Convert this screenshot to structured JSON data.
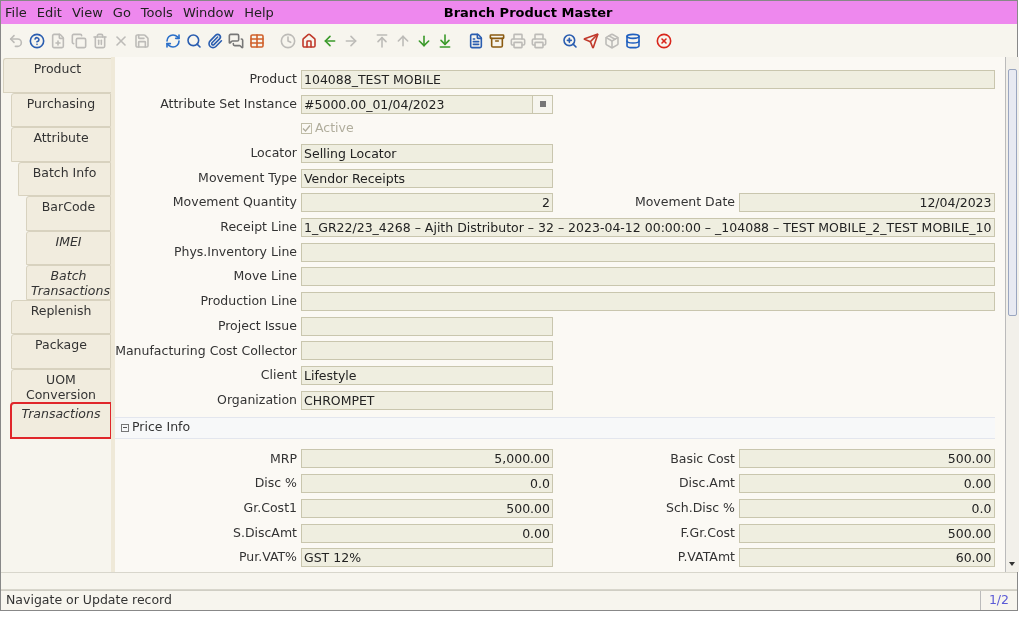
{
  "menu": [
    {
      "label": "File"
    },
    {
      "label": "Edit"
    },
    {
      "label": "View"
    },
    {
      "label": "Go"
    },
    {
      "label": "Tools"
    },
    {
      "label": "Window"
    },
    {
      "label": "Help"
    }
  ],
  "window": {
    "title": "Branch Product Master"
  },
  "toolbar": [
    {
      "kind": "undo",
      "disabled": true
    },
    {
      "kind": "help",
      "disabled": false
    },
    {
      "kind": "new",
      "disabled": true
    },
    {
      "kind": "copy",
      "disabled": true
    },
    {
      "kind": "delete",
      "disabled": true
    },
    {
      "kind": "delete-selection",
      "disabled": true
    },
    {
      "kind": "save",
      "disabled": true
    },
    {
      "kind": "sep"
    },
    {
      "kind": "refresh",
      "disabled": false
    },
    {
      "kind": "find",
      "disabled": false
    },
    {
      "kind": "attachment",
      "disabled": false
    },
    {
      "kind": "chat",
      "disabled": false
    },
    {
      "kind": "grid",
      "disabled": false
    },
    {
      "kind": "sep"
    },
    {
      "kind": "history",
      "disabled": true
    },
    {
      "kind": "home",
      "disabled": false
    },
    {
      "kind": "prev",
      "disabled": false
    },
    {
      "kind": "next",
      "disabled": true
    },
    {
      "kind": "sep"
    },
    {
      "kind": "first",
      "disabled": true
    },
    {
      "kind": "up",
      "disabled": true
    },
    {
      "kind": "down",
      "disabled": false
    },
    {
      "kind": "last",
      "disabled": false
    },
    {
      "kind": "sep"
    },
    {
      "kind": "report",
      "disabled": false
    },
    {
      "kind": "archive",
      "disabled": false
    },
    {
      "kind": "preview",
      "disabled": true
    },
    {
      "kind": "print",
      "disabled": true
    },
    {
      "kind": "sep"
    },
    {
      "kind": "zoom",
      "disabled": false
    },
    {
      "kind": "request",
      "disabled": false
    },
    {
      "kind": "product",
      "disabled": true
    },
    {
      "kind": "workflow",
      "disabled": false
    },
    {
      "kind": "sep"
    },
    {
      "kind": "close",
      "disabled": false
    }
  ],
  "tabs": [
    {
      "label": "Product",
      "selected": true,
      "italic": false,
      "highlighted": false,
      "children": [
        {
          "label": "Purchasing",
          "selected": false,
          "italic": false,
          "highlighted": false
        },
        {
          "label": "Attribute",
          "selected": false,
          "italic": false,
          "highlighted": false,
          "children": [
            {
              "label": "Batch Info",
              "selected": false,
              "italic": false,
              "highlighted": false,
              "children": [
                {
                  "label": "BarCode",
                  "selected": false,
                  "italic": false,
                  "highlighted": false
                },
                {
                  "label": "IMEI",
                  "selected": false,
                  "italic": true,
                  "highlighted": false
                },
                {
                  "label": "Batch Transactions",
                  "selected": false,
                  "italic": true,
                  "highlighted": false
                }
              ]
            }
          ]
        },
        {
          "label": "Replenish",
          "selected": false,
          "italic": false,
          "highlighted": false
        },
        {
          "label": "Package",
          "selected": false,
          "italic": false,
          "highlighted": false
        },
        {
          "label": "UOM Conversion",
          "selected": false,
          "italic": false,
          "highlighted": false
        },
        {
          "label": "Transactions",
          "selected": false,
          "italic": true,
          "highlighted": true
        }
      ]
    }
  ],
  "form": [
    [
      {
        "label": "Product",
        "value": "104088_TEST MOBILE",
        "kind": "long"
      }
    ],
    [
      {
        "label": "Attribute Set Instance",
        "value": "#5000.00_01/04/2023",
        "kind": "lookup"
      }
    ],
    [
      {
        "label": "Active",
        "checked": true,
        "disabled": true,
        "kind": "checkbox"
      }
    ],
    [
      {
        "label": "Locator",
        "value": "Selling Locator",
        "kind": "text"
      }
    ],
    [
      {
        "label": "Movement Type",
        "value": "Vendor Receipts",
        "kind": "text"
      }
    ],
    [
      {
        "label": "Movement Quantity",
        "value": "2",
        "kind": "number"
      },
      {
        "label": "Movement Date",
        "value": "12/04/2023",
        "kind": "number"
      }
    ],
    [
      {
        "label": "Receipt Line",
        "value": "1_GR22/23_4268 – Ajith Distributor – 32 – 2023-04-12 00:00:00 – _104088 – TEST MOBILE_2_TEST MOBILE_10",
        "kind": "long"
      }
    ],
    [
      {
        "label": "Phys.Inventory Line",
        "kind": "long"
      }
    ],
    [
      {
        "label": "Move Line",
        "kind": "long"
      }
    ],
    [
      {
        "label": "Production Line",
        "kind": "long"
      }
    ],
    [
      {
        "label": "Project Issue",
        "kind": "text"
      }
    ],
    [
      {
        "label": "Manufacturing Cost Collector",
        "kind": "text"
      }
    ],
    [
      {
        "label": "Client",
        "value": "Lifestyle",
        "kind": "text"
      }
    ],
    [
      {
        "label": "Organization",
        "value": "CHROMPET",
        "kind": "text"
      }
    ]
  ],
  "price_info": {
    "title": "Price Info",
    "expanded": true,
    "rows": [
      [
        {
          "label": "MRP",
          "value": "5,000.00",
          "kind": "number"
        },
        {
          "label": "Basic Cost",
          "value": "500.00",
          "kind": "number"
        }
      ],
      [
        {
          "label": "Disc %",
          "value": "0.0",
          "kind": "number"
        },
        {
          "label": "Disc.Amt",
          "value": "0.00",
          "kind": "number"
        }
      ],
      [
        {
          "label": "Gr.Cost1",
          "value": "500.00",
          "kind": "number"
        },
        {
          "label": "Sch.Disc %",
          "value": "0.0",
          "kind": "number"
        }
      ],
      [
        {
          "label": "S.DiscAmt",
          "value": "0.00",
          "kind": "number"
        },
        {
          "label": "F.Gr.Cost",
          "value": "500.00",
          "kind": "number"
        }
      ],
      [
        {
          "label": "Pur.VAT%",
          "value": "GST 12%",
          "kind": "text"
        },
        {
          "label": "P.VATAmt",
          "value": "60.00",
          "kind": "number"
        }
      ]
    ]
  },
  "status_bar": {
    "message": "Navigate or Update record",
    "record": "1/2"
  }
}
